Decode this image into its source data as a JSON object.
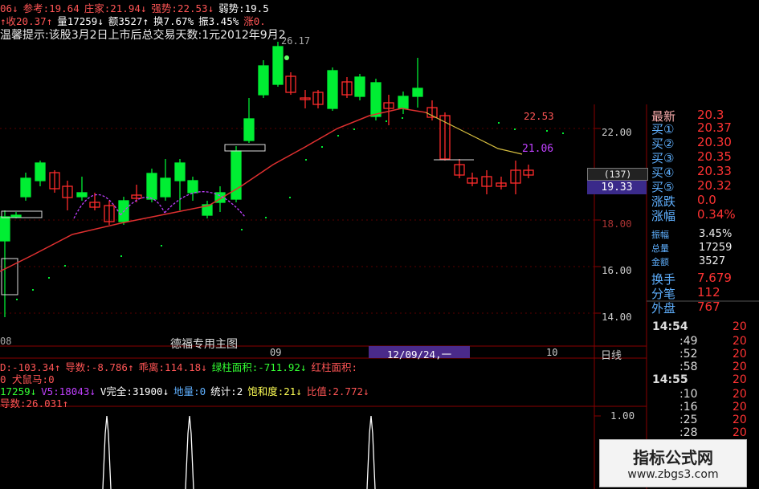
{
  "colors": {
    "up": "#ff2b2b",
    "down": "#00ee33",
    "ma": "#e03030",
    "ma2": "#d8c040",
    "grid": "#8a0000",
    "label_blue": "#5fb0ff",
    "purple": "#c040ff"
  },
  "info_bar": {
    "row1": [
      {
        "text": "06↓",
        "color": "#ff5555"
      },
      {
        "text": "参考:19.64",
        "color": "#ff5555"
      },
      {
        "text": "庄家:21.94↓",
        "color": "#ff5555"
      },
      {
        "text": "强势:22.53↓",
        "color": "#ff5555"
      },
      {
        "text": "弱势:19.5",
        "color": "#ffffff"
      }
    ],
    "row2": [
      {
        "text": "↑收20.37↑",
        "color": "#ff5555"
      },
      {
        "text": "量17259↓",
        "color": "#ffffff"
      },
      {
        "text": "额3527↑",
        "color": "#ffffff"
      },
      {
        "text": "换7.67%",
        "color": "#ffffff"
      },
      {
        "text": "振3.45%",
        "color": "#ffffff"
      },
      {
        "text": "涨0.",
        "color": "#ff5555"
      }
    ],
    "notice": "温馨提示:该股3月2日上市后总交易天数:1元2012年9月2"
  },
  "chart_labels": {
    "high_label": "26.17",
    "right_label_1": "22.53",
    "right_label_2": "21.06",
    "main_chart_title": "德福专用主图",
    "date_cursor": "12/09/24,一",
    "date_tick_1": "09",
    "date_tick_2": "10",
    "date_tick_left": "08",
    "period": "日线",
    "cursor_price": "19.33",
    "cursor_small": "(137)"
  },
  "price_axis": [
    {
      "label": "22.00"
    },
    {
      "label": "18.00"
    },
    {
      "label": "16.00"
    },
    {
      "label": "14.00"
    }
  ],
  "volume_axis": {
    "label": "1.00"
  },
  "quote_panel": {
    "header": "最新",
    "header_val": "20.3",
    "rows": [
      {
        "label": "买①",
        "value": "20.37"
      },
      {
        "label": "买②",
        "value": "20.30"
      },
      {
        "label": "买③",
        "value": "20.35"
      },
      {
        "label": "买④",
        "value": "20.33"
      },
      {
        "label": "买⑤",
        "value": "20.32"
      },
      {
        "label": "涨跌",
        "value": "0.0"
      },
      {
        "label": "涨幅",
        "value": "0.34%"
      }
    ],
    "small_rows": [
      {
        "label": "振幅",
        "value": "3.45%"
      },
      {
        "label": "总量",
        "value": "17259"
      },
      {
        "label": "金额",
        "value": "3527"
      }
    ],
    "rows2": [
      {
        "label": "换手",
        "value": "7.679"
      },
      {
        "label": "分笔",
        "value": "112"
      },
      {
        "label": "外盘",
        "value": "767"
      }
    ],
    "ticks": [
      {
        "time": "14:54",
        "value": "20",
        "big": true
      },
      {
        "time": ":49",
        "value": "20",
        "big": false
      },
      {
        "time": ":52",
        "value": "20",
        "big": false
      },
      {
        "time": ":58",
        "value": "20",
        "big": false
      },
      {
        "time": "14:55",
        "value": "20",
        "big": true
      },
      {
        "time": ":10",
        "value": "20",
        "big": false
      },
      {
        "time": ":16",
        "value": "20",
        "big": false
      },
      {
        "time": ":25",
        "value": "20",
        "big": false
      },
      {
        "time": ":28",
        "value": "20",
        "big": false
      }
    ]
  },
  "indicators": {
    "row1": [
      {
        "text": "D:-103.34↑",
        "color": "#ff5555"
      },
      {
        "text": "导数:-8.786↑",
        "color": "#ff5555"
      },
      {
        "text": "乖离:114.18↓",
        "color": "#ff5555"
      },
      {
        "text": "绿柱面积:-711.92↓",
        "color": "#33ff33"
      },
      {
        "text": "红柱面积:",
        "color": "#ff5555"
      }
    ],
    "row2": [
      {
        "text": "0 犬鼠马:0",
        "color": "#ff5555"
      }
    ],
    "row3": [
      {
        "text": "17259↓",
        "color": "#33ff33"
      },
      {
        "text": "V5:18043↓",
        "color": "#c040ff"
      },
      {
        "text": "V完全:31900↓",
        "color": "#ffffff"
      },
      {
        "text": "地量:0",
        "color": "#5fb0ff"
      },
      {
        "text": "统计:2",
        "color": "#ffffff"
      },
      {
        "text": "饱和度:21↓",
        "color": "#ffff55"
      },
      {
        "text": "比值:2.772↓",
        "color": "#ff5555"
      }
    ],
    "row4": [
      {
        "text": "导数:26.031↑",
        "color": "#ff5555"
      }
    ]
  },
  "watermark": {
    "title": "指标公式网",
    "url": "www.zbgs3.com"
  }
}
